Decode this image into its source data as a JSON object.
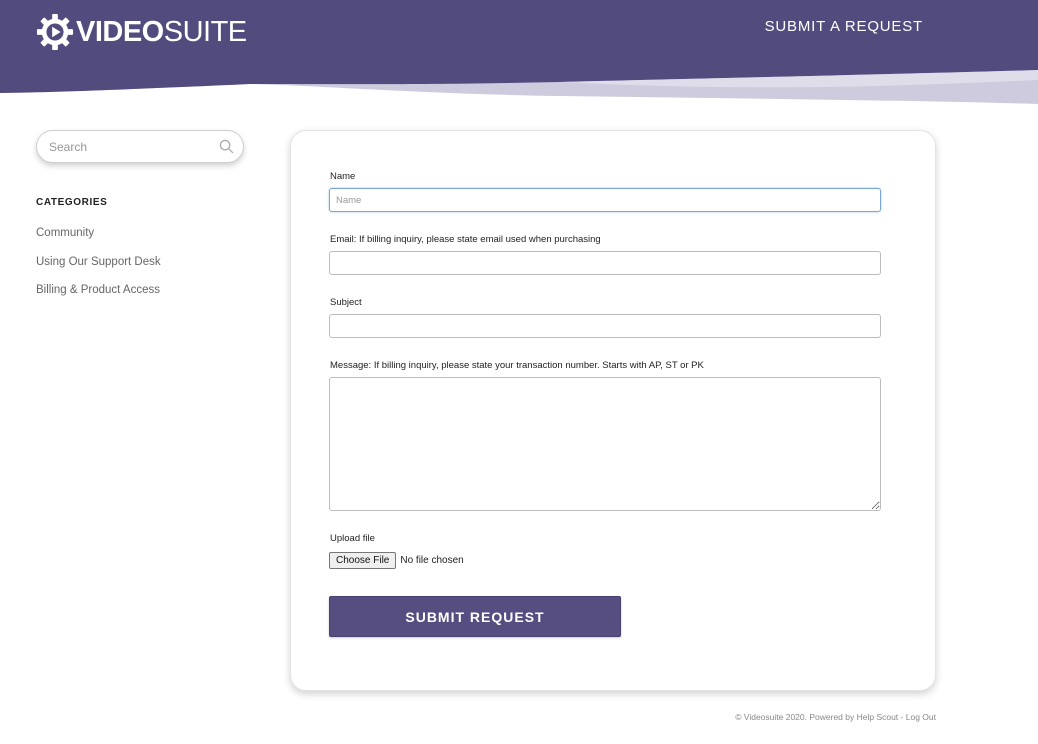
{
  "header": {
    "logo_bold": "VIDEO",
    "logo_light": "SUITE",
    "submit_link": "SUBMIT A REQUEST",
    "brand_color": "#524b7e",
    "wave_color": "#cfcbdf"
  },
  "sidebar": {
    "search_placeholder": "Search",
    "categories_heading": "CATEGORIES",
    "categories": [
      {
        "label": "Community"
      },
      {
        "label": "Using Our Support Desk"
      },
      {
        "label": "Billing & Product Access"
      }
    ]
  },
  "form": {
    "name_label": "Name",
    "name_placeholder": "Name",
    "email_label": "Email: If billing inquiry, please state email used when purchasing",
    "subject_label": "Subject",
    "message_label": "Message: If billing inquiry, please state your transaction number. Starts with AP, ST or PK",
    "upload_label": "Upload file",
    "choose_file_label": "Choose File",
    "file_status": "No file chosen",
    "submit_label": "SUBMIT REQUEST",
    "button_color": "#564e81"
  },
  "footer": {
    "copyright": "© Videosuite 2020. Powered by Help Scout",
    "separator": " - ",
    "logout": "Log Out"
  }
}
